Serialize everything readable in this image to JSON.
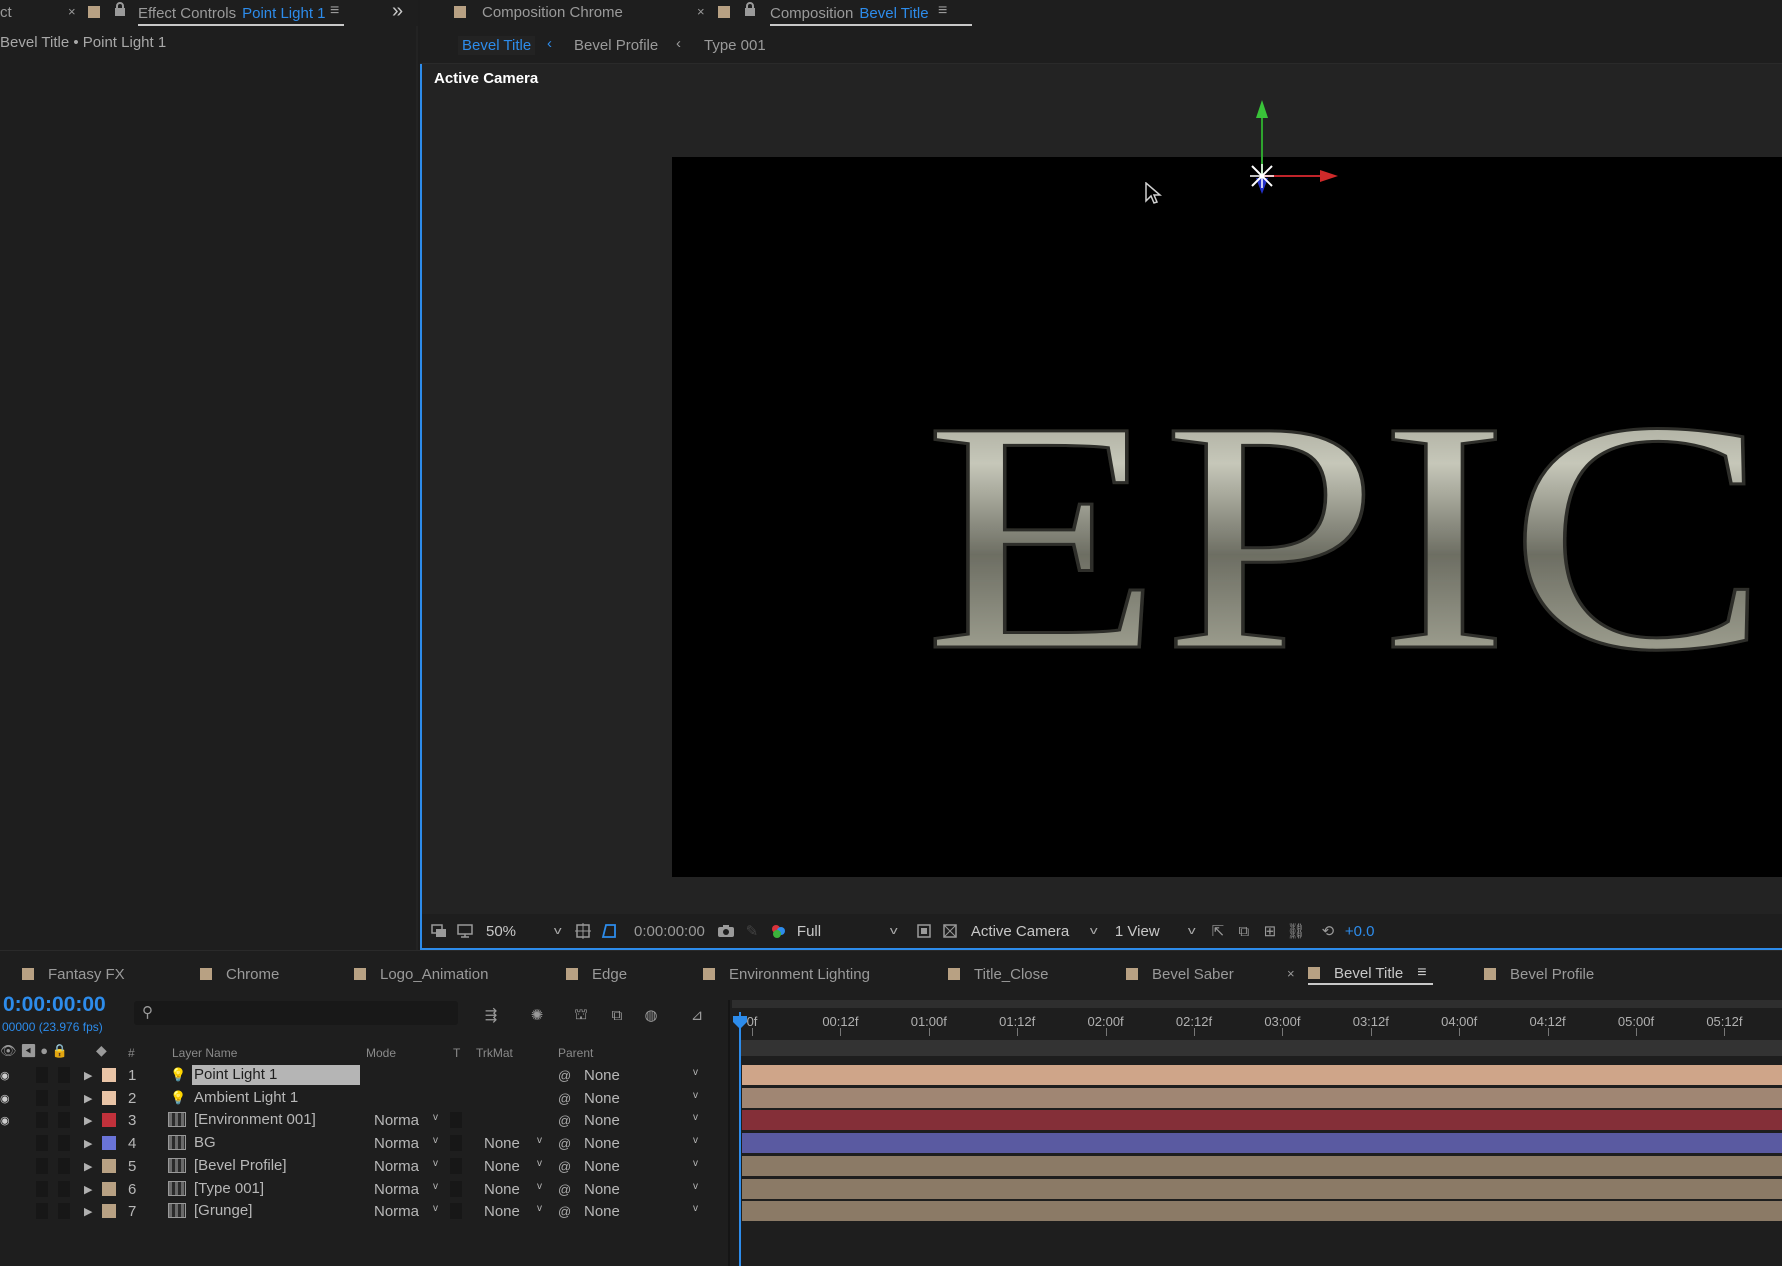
{
  "effect_panel": {
    "tab_fragment": "ct",
    "tab_prefix": "Effect Controls",
    "tab_layer": "Point Light 1",
    "breadcrumb": "Bevel Title • Point Light 1"
  },
  "comp_panel": {
    "tab_inactive": "Composition Chrome",
    "tab_prefix": "Composition",
    "tab_active_name": "Bevel Title",
    "nav": [
      "Bevel Title",
      "Bevel Profile",
      "Type 001"
    ],
    "viewport_label": "Active Camera",
    "canvas_text": "EPIC"
  },
  "viewer_toolbar": {
    "zoom": "50%",
    "timecode": "0:00:00:00",
    "resolution": "Full",
    "camera": "Active Camera",
    "views": "1 View",
    "exposure": "+0.0"
  },
  "timeline_tabs": [
    "Fantasy FX",
    "Chrome",
    "Logo_Animation",
    "Edge",
    "Environment Lighting",
    "Title_Close",
    "Bevel Saber",
    "Bevel Title",
    "Bevel Profile"
  ],
  "timeline": {
    "timecode": "0:00:00:00",
    "frame_info": "00000 (23.976 fps)",
    "headers": {
      "num": "#",
      "layer_name": "Layer Name",
      "mode": "Mode",
      "t": "T",
      "trkmat": "TrkMat",
      "parent": "Parent"
    },
    "ruler": [
      "0f",
      "00:12f",
      "01:00f",
      "01:12f",
      "02:00f",
      "02:12f",
      "03:00f",
      "03:12f",
      "04:00f",
      "04:12f",
      "05:00f",
      "05:12f"
    ],
    "layers": [
      {
        "num": "1",
        "name": "Point Light 1",
        "mode": "",
        "trkmat": "",
        "parent": "None",
        "label_color": "#e9c4a6",
        "bar_color": "#cfa589",
        "selected": true,
        "type": "light",
        "eye": true
      },
      {
        "num": "2",
        "name": "Ambient Light 1",
        "mode": "",
        "trkmat": "",
        "parent": "None",
        "label_color": "#e9c4a6",
        "bar_color": "#a08673",
        "selected": false,
        "type": "light",
        "eye": true
      },
      {
        "num": "3",
        "name": "[Environment 001]",
        "mode": "Norma",
        "trkmat": "",
        "parent": "None",
        "label_color": "#c1313b",
        "bar_color": "#842f38",
        "selected": false,
        "type": "comp",
        "eye": true
      },
      {
        "num": "4",
        "name": "BG",
        "mode": "Norma",
        "trkmat": "None",
        "parent": "None",
        "label_color": "#6a74d8",
        "bar_color": "#5a5aa1",
        "selected": false,
        "type": "comp",
        "eye": false
      },
      {
        "num": "5",
        "name": "[Bevel Profile]",
        "mode": "Norma",
        "trkmat": "None",
        "parent": "None",
        "label_color": "#b8a183",
        "bar_color": "#8b7a66",
        "selected": false,
        "type": "comp",
        "eye": false
      },
      {
        "num": "6",
        "name": "[Type 001]",
        "mode": "Norma",
        "trkmat": "None",
        "parent": "None",
        "label_color": "#b8a183",
        "bar_color": "#8b7a66",
        "selected": false,
        "type": "comp",
        "eye": false
      },
      {
        "num": "7",
        "name": "[Grunge]",
        "mode": "Norma",
        "trkmat": "None",
        "parent": "None",
        "label_color": "#b8a183",
        "bar_color": "#8b7a66",
        "selected": false,
        "type": "comp",
        "eye": false
      }
    ]
  }
}
